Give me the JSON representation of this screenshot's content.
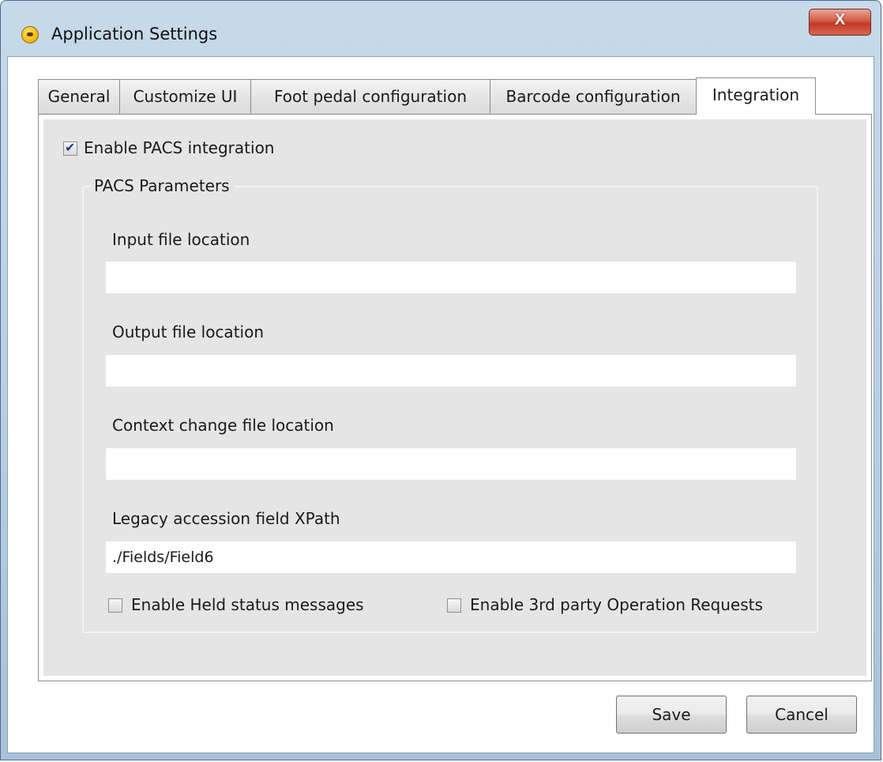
{
  "window": {
    "title": "Application Settings",
    "close_label": "X"
  },
  "tabs": [
    {
      "label": "General",
      "active": false
    },
    {
      "label": "Customize UI",
      "active": false
    },
    {
      "label": "Foot pedal configuration",
      "active": false
    },
    {
      "label": "Barcode configuration",
      "active": false
    },
    {
      "label": "Integration",
      "active": true
    }
  ],
  "integration": {
    "enable_pacs": {
      "label": "Enable PACS integration",
      "checked": true
    },
    "group_title": "PACS Parameters",
    "fields": {
      "input_file": {
        "label": "Input file location",
        "value": ""
      },
      "output_file": {
        "label": "Output file location",
        "value": ""
      },
      "context_change_file": {
        "label": "Context change file location",
        "value": ""
      },
      "legacy_xpath": {
        "label": "Legacy accession field XPath",
        "value": "./Fields/Field6"
      }
    },
    "enable_held_status": {
      "label": "Enable Held status messages",
      "checked": false
    },
    "enable_third_party": {
      "label": "Enable 3rd party Operation Requests",
      "checked": false
    }
  },
  "buttons": {
    "save": "Save",
    "cancel": "Cancel"
  }
}
